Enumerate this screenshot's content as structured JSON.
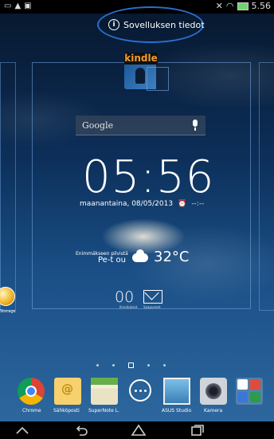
{
  "status_bar": {
    "left_icons": [
      "screenshot-icon",
      "warning-icon",
      "notification-icon"
    ],
    "right_icons": [
      "mute-icon",
      "wifi-icon",
      "battery-icon"
    ],
    "time": "5.56"
  },
  "app_info_hint": {
    "label": "Sovelluksen tiedot"
  },
  "widgets": {
    "kindle": {
      "label": "kindle"
    },
    "search": {
      "label": "Google"
    },
    "clock": {
      "time": "05:56",
      "date": "maanantaina, 08/05/2013",
      "alarm": "--:--"
    },
    "weather": {
      "description": "Enimmäkseen pilvistä",
      "day": "Pe-t ou",
      "temperature": "32°C"
    },
    "missed_calls": {
      "count": "00",
      "sub": "Ilmoitukset"
    },
    "messages": {
      "sub": "Saapuneet"
    },
    "storage": {
      "label": "Storage"
    }
  },
  "pager": {
    "pages": 5,
    "current": 2
  },
  "dock": [
    {
      "label": "Chrome"
    },
    {
      "label": "Sähköposti"
    },
    {
      "label": "SuperNote L."
    },
    {
      "label": ""
    },
    {
      "label": "ASUS Studio"
    },
    {
      "label": "Kamera"
    },
    {
      "label": ""
    }
  ],
  "colors": {
    "accent": "#2a6fd0",
    "background_top": "#07172c",
    "background_bottom": "#2f6aa0"
  }
}
